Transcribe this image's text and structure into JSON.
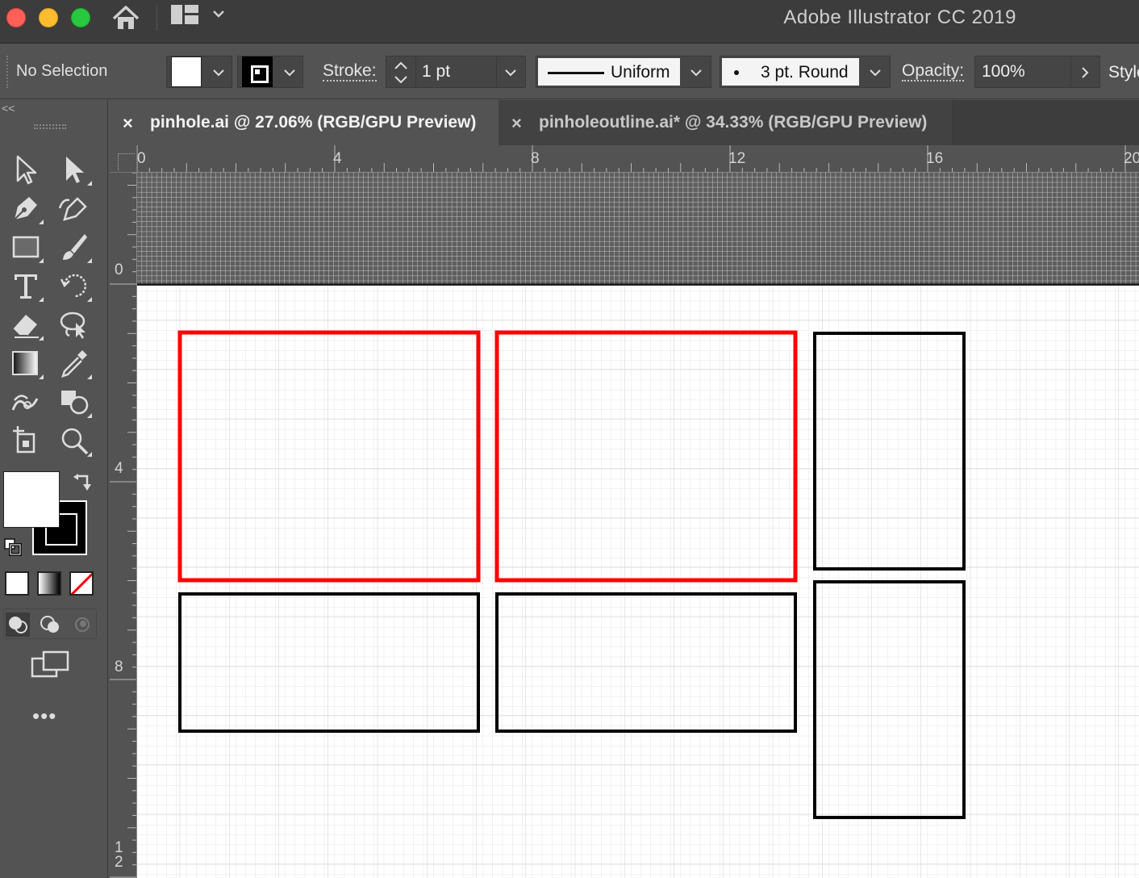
{
  "window": {
    "title": "Adobe Illustrator CC 2019",
    "icons": [
      "close-button",
      "minimize-button",
      "maximize-button",
      "home-icon",
      "workspace-switcher-icon",
      "chevron-down-icon"
    ]
  },
  "control_bar": {
    "selection_status": "No Selection",
    "stroke_label": "Stroke:",
    "stroke_weight": "1 pt",
    "variable_width_profile": "Uniform",
    "brush_definition": "3 pt. Round",
    "opacity_label": "Opacity:",
    "opacity_value": "100%",
    "style_label": "Style"
  },
  "tool_panel": {
    "collapse_label": "<<",
    "tools": [
      "selection-tool",
      "direct-selection-tool",
      "pen-tool",
      "curvature-tool",
      "rectangle-tool",
      "paintbrush-tool",
      "type-tool",
      "rotate-tool",
      "eraser-tool",
      "lasso-tool",
      "gradient-tool",
      "eyedropper-tool",
      "puppet-warp-tool",
      "shape-builder-tool",
      "artboard-tool",
      "zoom-tool"
    ],
    "fill_color": "#ffffff",
    "stroke_color": "#000000",
    "more_label": "•••"
  },
  "tabs": [
    {
      "close": "×",
      "label": "pinhole.ai @ 27.06% (RGB/GPU Preview)",
      "active": true
    },
    {
      "close": "×",
      "label": "pinholeoutline.ai* @ 34.33% (RGB/GPU Preview)",
      "active": false
    }
  ],
  "rulers": {
    "horizontal_labels": [
      "0",
      "4",
      "8",
      "12",
      "16",
      "20"
    ],
    "vertical_labels": [
      "0",
      "4",
      "8",
      "1\n2"
    ]
  },
  "artwork": {
    "highlight_color": "#ff0000",
    "outline_color": "#000000",
    "rectangles": [
      {
        "name": "top-left-panel",
        "stroke": "red"
      },
      {
        "name": "top-middle-panel",
        "stroke": "red"
      },
      {
        "name": "top-right-panel",
        "stroke": "black"
      },
      {
        "name": "bottom-left-panel",
        "stroke": "black"
      },
      {
        "name": "bottom-middle-panel",
        "stroke": "black"
      },
      {
        "name": "bottom-right-panel",
        "stroke": "black"
      }
    ]
  }
}
